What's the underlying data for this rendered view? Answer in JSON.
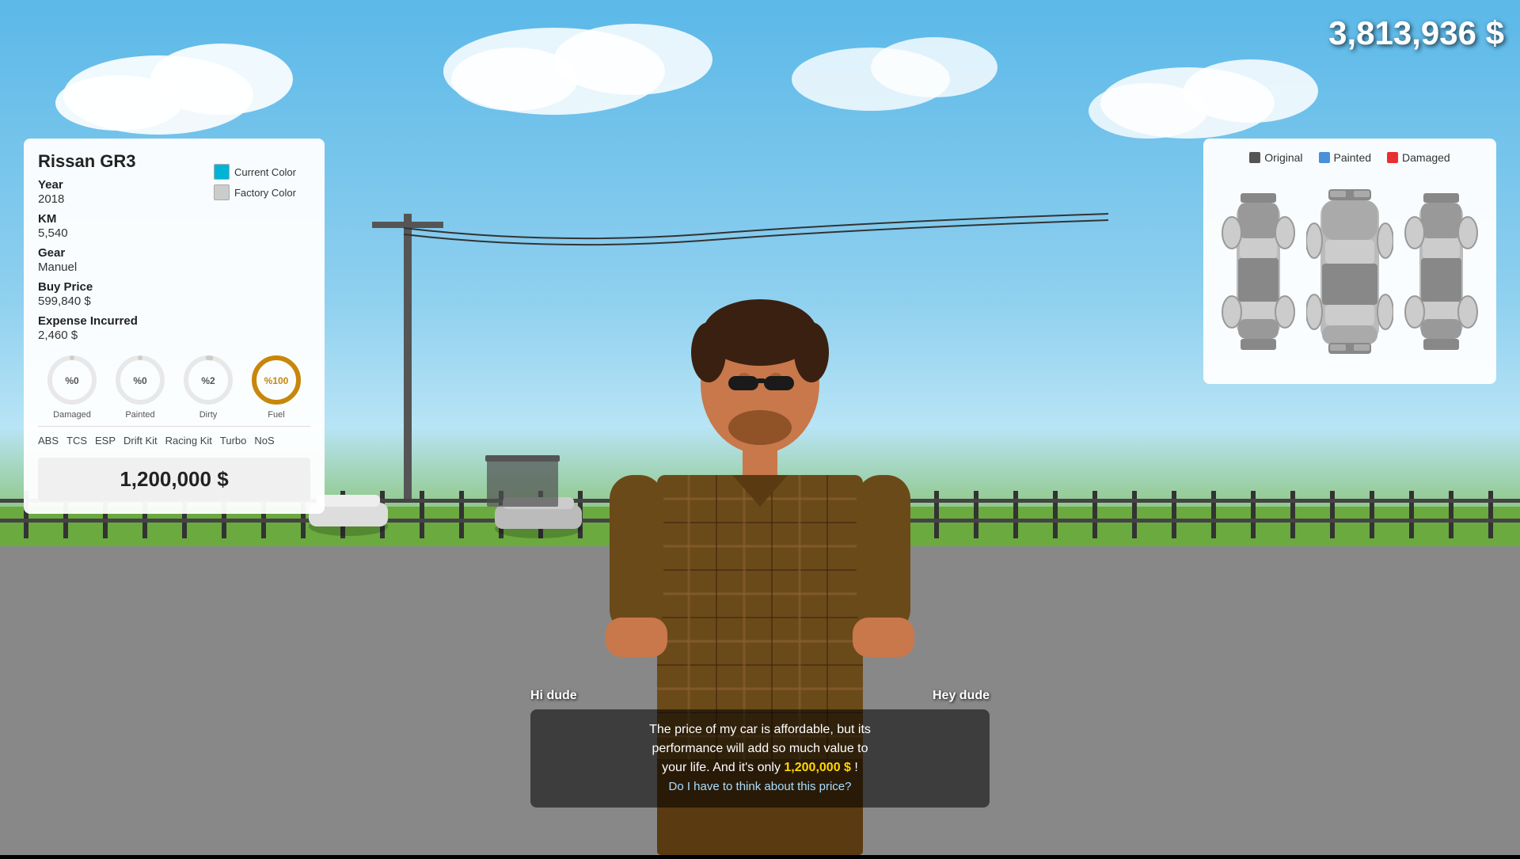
{
  "money": "3,813,936 $",
  "car": {
    "title": "Rissan GR3",
    "currentColor": "#00b4d8",
    "factoryColor": "#cccccc",
    "currentColorLabel": "Current Color",
    "factoryColorLabel": "Factory Color",
    "year": {
      "label": "Year",
      "value": "2018"
    },
    "km": {
      "label": "KM",
      "value": "5,540"
    },
    "gear": {
      "label": "Gear",
      "value": "Manuel"
    },
    "buyPrice": {
      "label": "Buy Price",
      "value": "599,840 $"
    },
    "expenseIncurred": {
      "label": "Expense Incurred",
      "value": "2,460 $"
    },
    "gauges": [
      {
        "label": "Damaged",
        "value": "%0",
        "percent": 0,
        "color": "#ccc",
        "trackColor": "#eee"
      },
      {
        "label": "Painted",
        "value": "%0",
        "percent": 0,
        "color": "#ccc",
        "trackColor": "#eee"
      },
      {
        "label": "Dirty",
        "value": "%2",
        "percent": 2,
        "color": "#ccc",
        "trackColor": "#eee"
      },
      {
        "label": "Fuel",
        "value": "%100",
        "percent": 100,
        "color": "#c8860a",
        "trackColor": "#eee"
      }
    ],
    "features": [
      "ABS",
      "TCS",
      "ESP",
      "Drift Kit",
      "Racing Kit",
      "Turbo",
      "NoS"
    ],
    "sellPrice": "1,200,000 $"
  },
  "diagram": {
    "legend": [
      {
        "label": "Original",
        "color": "#555"
      },
      {
        "label": "Painted",
        "color": "#4a90d9"
      },
      {
        "label": "Damaged",
        "color": "#e83030"
      }
    ]
  },
  "dialogue": {
    "speakerLeft": "Hi dude",
    "speakerRight": "Hey dude",
    "line1": "The price of my car is affordable, but its",
    "line2": "performance will add so much value to",
    "line3": "your life. And it's only",
    "highlight": "1,200,000 $",
    "line4": "!",
    "question": "Do I have to think about this price?"
  }
}
